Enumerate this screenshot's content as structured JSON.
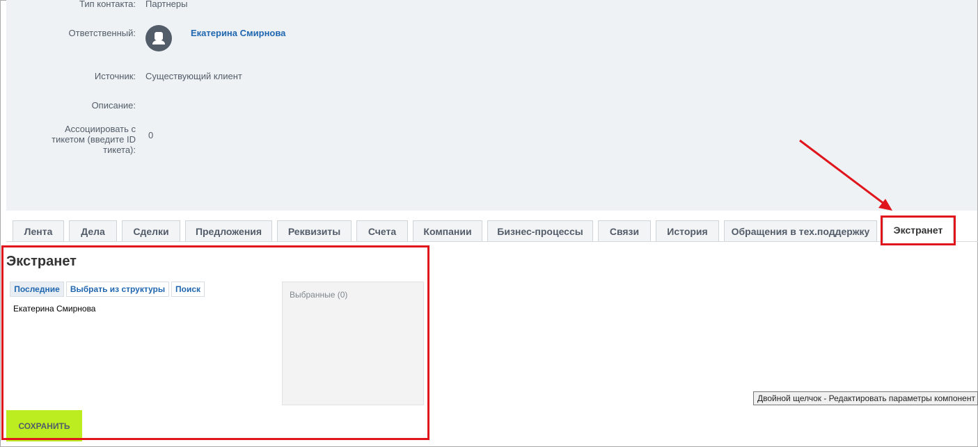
{
  "details": {
    "contact_type": {
      "label": "Тип контакта:",
      "value": "Партнеры"
    },
    "responsible": {
      "label": "Ответственный:",
      "name": "Екатерина Смирнова"
    },
    "source": {
      "label": "Источник:",
      "value": "Существующий клиент"
    },
    "description": {
      "label": "Описание:"
    },
    "ticket": {
      "label_line1": "Ассоциировать с",
      "label_line2": "тикетом (введите ID",
      "label_line3": "тикета):",
      "value": "0"
    }
  },
  "tabs": [
    "Лента",
    "Дела",
    "Сделки",
    "Предложения",
    "Реквизиты",
    "Счета",
    "Компании",
    "Бизнес-процессы",
    "Связи",
    "История",
    "Обращения в тех.поддержку",
    "Экстранет"
  ],
  "active_tab": "Экстранет",
  "extranet": {
    "title": "Экстранет",
    "selector_tabs": [
      "Последние",
      "Выбрать из структуры",
      "Поиск"
    ],
    "recent_items": [
      "Екатерина Смирнова"
    ],
    "selected_label": "Выбранные (0)"
  },
  "hint": "Двойной щелчок - Редактировать параметры компонент",
  "save_button": "СОХРАНИТЬ",
  "colors": {
    "annotation_red": "#e0141b",
    "save_green": "#bbed21",
    "link_blue": "#2067b0"
  },
  "icons": {
    "avatar": "user-avatar-icon"
  }
}
